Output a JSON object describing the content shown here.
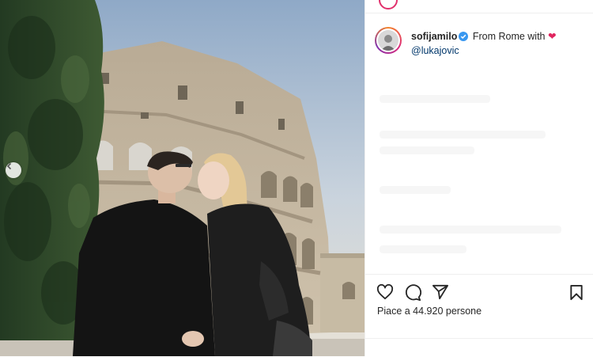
{
  "post": {
    "username": "sofijamilo",
    "caption_text": "From Rome with",
    "caption_emoji": "❤",
    "mention": "@lukajovic",
    "likes_text": "Piace a 44.920 persone"
  },
  "icons": {
    "carousel_prev": "chevron-left-icon",
    "like": "heart-outline-icon",
    "comment": "speech-bubble-icon",
    "share": "paper-plane-icon",
    "save": "bookmark-icon",
    "verified": "verified-badge-icon"
  },
  "colors": {
    "verified_badge": "#3897f0",
    "heart_emoji": "#e0245e",
    "mention": "#00376b",
    "text": "#262626",
    "divider": "#efefef"
  }
}
